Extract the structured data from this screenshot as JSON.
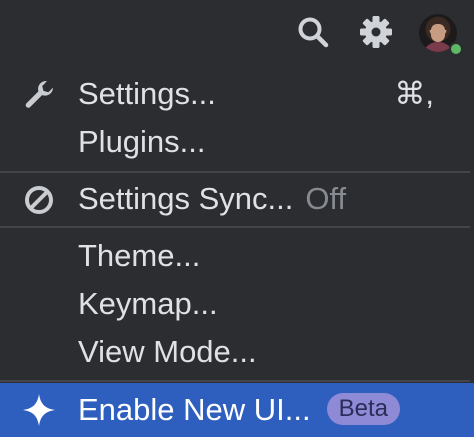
{
  "toolbar": {
    "search_icon": "search-icon",
    "settings_icon": "gear-icon",
    "avatar_status_color": "#5fb865"
  },
  "menu": {
    "settings": {
      "label": "Settings...",
      "shortcut": "⌘,",
      "icon": "wrench-icon"
    },
    "plugins": {
      "label": "Plugins..."
    },
    "settings_sync": {
      "label": "Settings Sync...",
      "hint": "Off",
      "icon": "no-entry-icon"
    },
    "theme": {
      "label": "Theme..."
    },
    "keymap": {
      "label": "Keymap..."
    },
    "view_mode": {
      "label": "View Mode..."
    },
    "new_ui": {
      "label": "Enable New UI...",
      "badge": "Beta",
      "icon": "sparkle-icon"
    }
  },
  "colors": {
    "background": "#2b2d30",
    "text": "#dfe1e5",
    "muted": "#868a91",
    "highlight": "#2e5fbf",
    "badge": "#8e8ad6"
  }
}
